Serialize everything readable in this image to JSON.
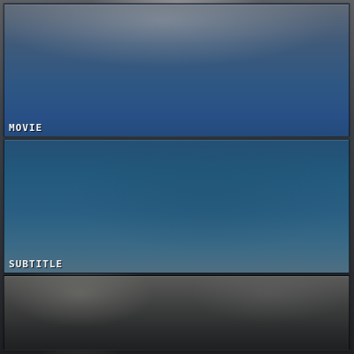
{
  "menu": {
    "items": [
      {
        "label": "MOVIE"
      },
      {
        "label": "SUBTITLE"
      }
    ]
  }
}
